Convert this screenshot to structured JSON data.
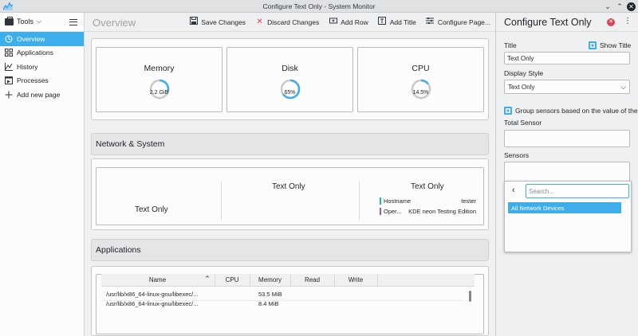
{
  "window": {
    "title": "Configure Text Only - System Monitor"
  },
  "sidebar": {
    "tools_label": "Tools",
    "items": [
      {
        "label": "Overview",
        "icon": "overview-icon",
        "active": true
      },
      {
        "label": "Applications",
        "icon": "applications-icon"
      },
      {
        "label": "History",
        "icon": "history-icon"
      },
      {
        "label": "Processes",
        "icon": "processes-icon"
      },
      {
        "label": "Add new page",
        "icon": "plus-icon"
      }
    ]
  },
  "main": {
    "page_title": "Overview",
    "toolbar": {
      "save": "Save Changes",
      "discard": "Discard Changes",
      "add_row": "Add Row",
      "add_title": "Add Title",
      "configure": "Configure Page..."
    },
    "gauges": [
      {
        "label": "Memory",
        "value_text": "2.2 GiB",
        "fraction": 0.3
      },
      {
        "label": "Disk",
        "value_text": "65%",
        "fraction": 0.65
      },
      {
        "label": "CPU",
        "value_text": "14.5%",
        "fraction": 0.145
      }
    ],
    "network_title": "Network & System",
    "network": {
      "col1": "Text Only",
      "col2": "Text Only",
      "col3": "Text Only",
      "hostname_label": "Hostname",
      "hostname_value": "tester",
      "os_label": "Oper...",
      "os_value": "KDE neon Testing Edition"
    },
    "applications_title": "Applications",
    "table": {
      "columns": [
        "Name",
        "CPU",
        "Memory",
        "Read",
        "Write"
      ],
      "rows": [
        {
          "name": "/usr/lib/x86_64-linux-gnu/libexec/...",
          "memory": "53.5 MiB"
        },
        {
          "name": "/usr/lib/x86_64-linux-gnu/libexec/...",
          "memory": "8.4 MiB"
        }
      ]
    }
  },
  "panel": {
    "title": "Configure Text Only",
    "title_label": "Title",
    "show_title": "Show Title",
    "title_value": "Text Only",
    "display_style_label": "Display Style",
    "display_style_value": "Text Only",
    "group_sensors": "Group sensors based on the value of the total",
    "total_sensor_label": "Total Sensor",
    "sensors_label": "Sensors",
    "search_placeholder": "Search...",
    "search_option": "All Network Devices"
  },
  "colors": {
    "accent": "#3daee9",
    "close_red": "#da4453",
    "ring_track": "#c8cacc",
    "host_bar": "#1abc9c",
    "os_bar": "#9b59b6"
  }
}
